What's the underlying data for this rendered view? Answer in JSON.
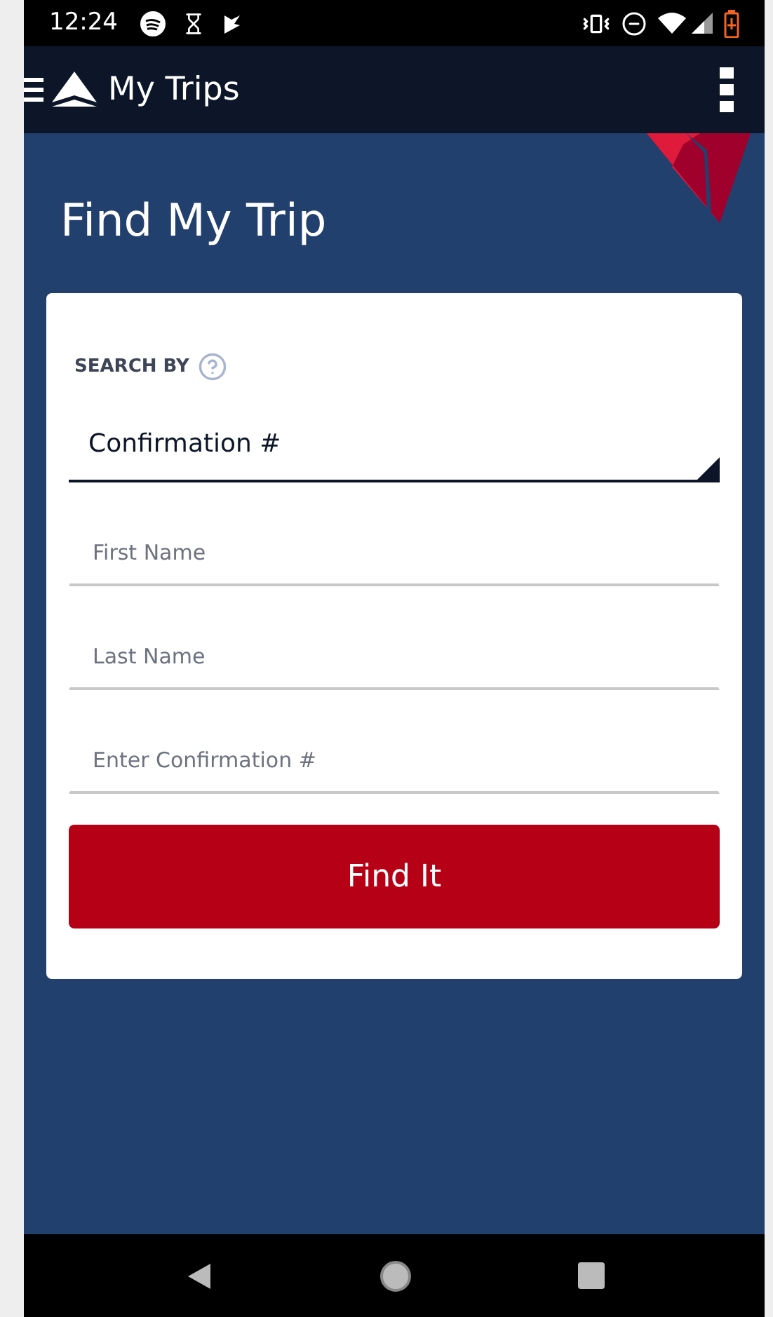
{
  "status_bar": {
    "time": "12:24"
  },
  "app_bar": {
    "title": "My Trips"
  },
  "page": {
    "heading": "Find My Trip"
  },
  "form": {
    "search_by_label": "SEARCH BY",
    "search_by": {
      "value": "Confirmation #"
    },
    "fields": [
      {
        "placeholder": "First Name"
      },
      {
        "placeholder": "Last Name"
      },
      {
        "placeholder": "Enter Confirmation #"
      }
    ],
    "submit": "Find It"
  }
}
